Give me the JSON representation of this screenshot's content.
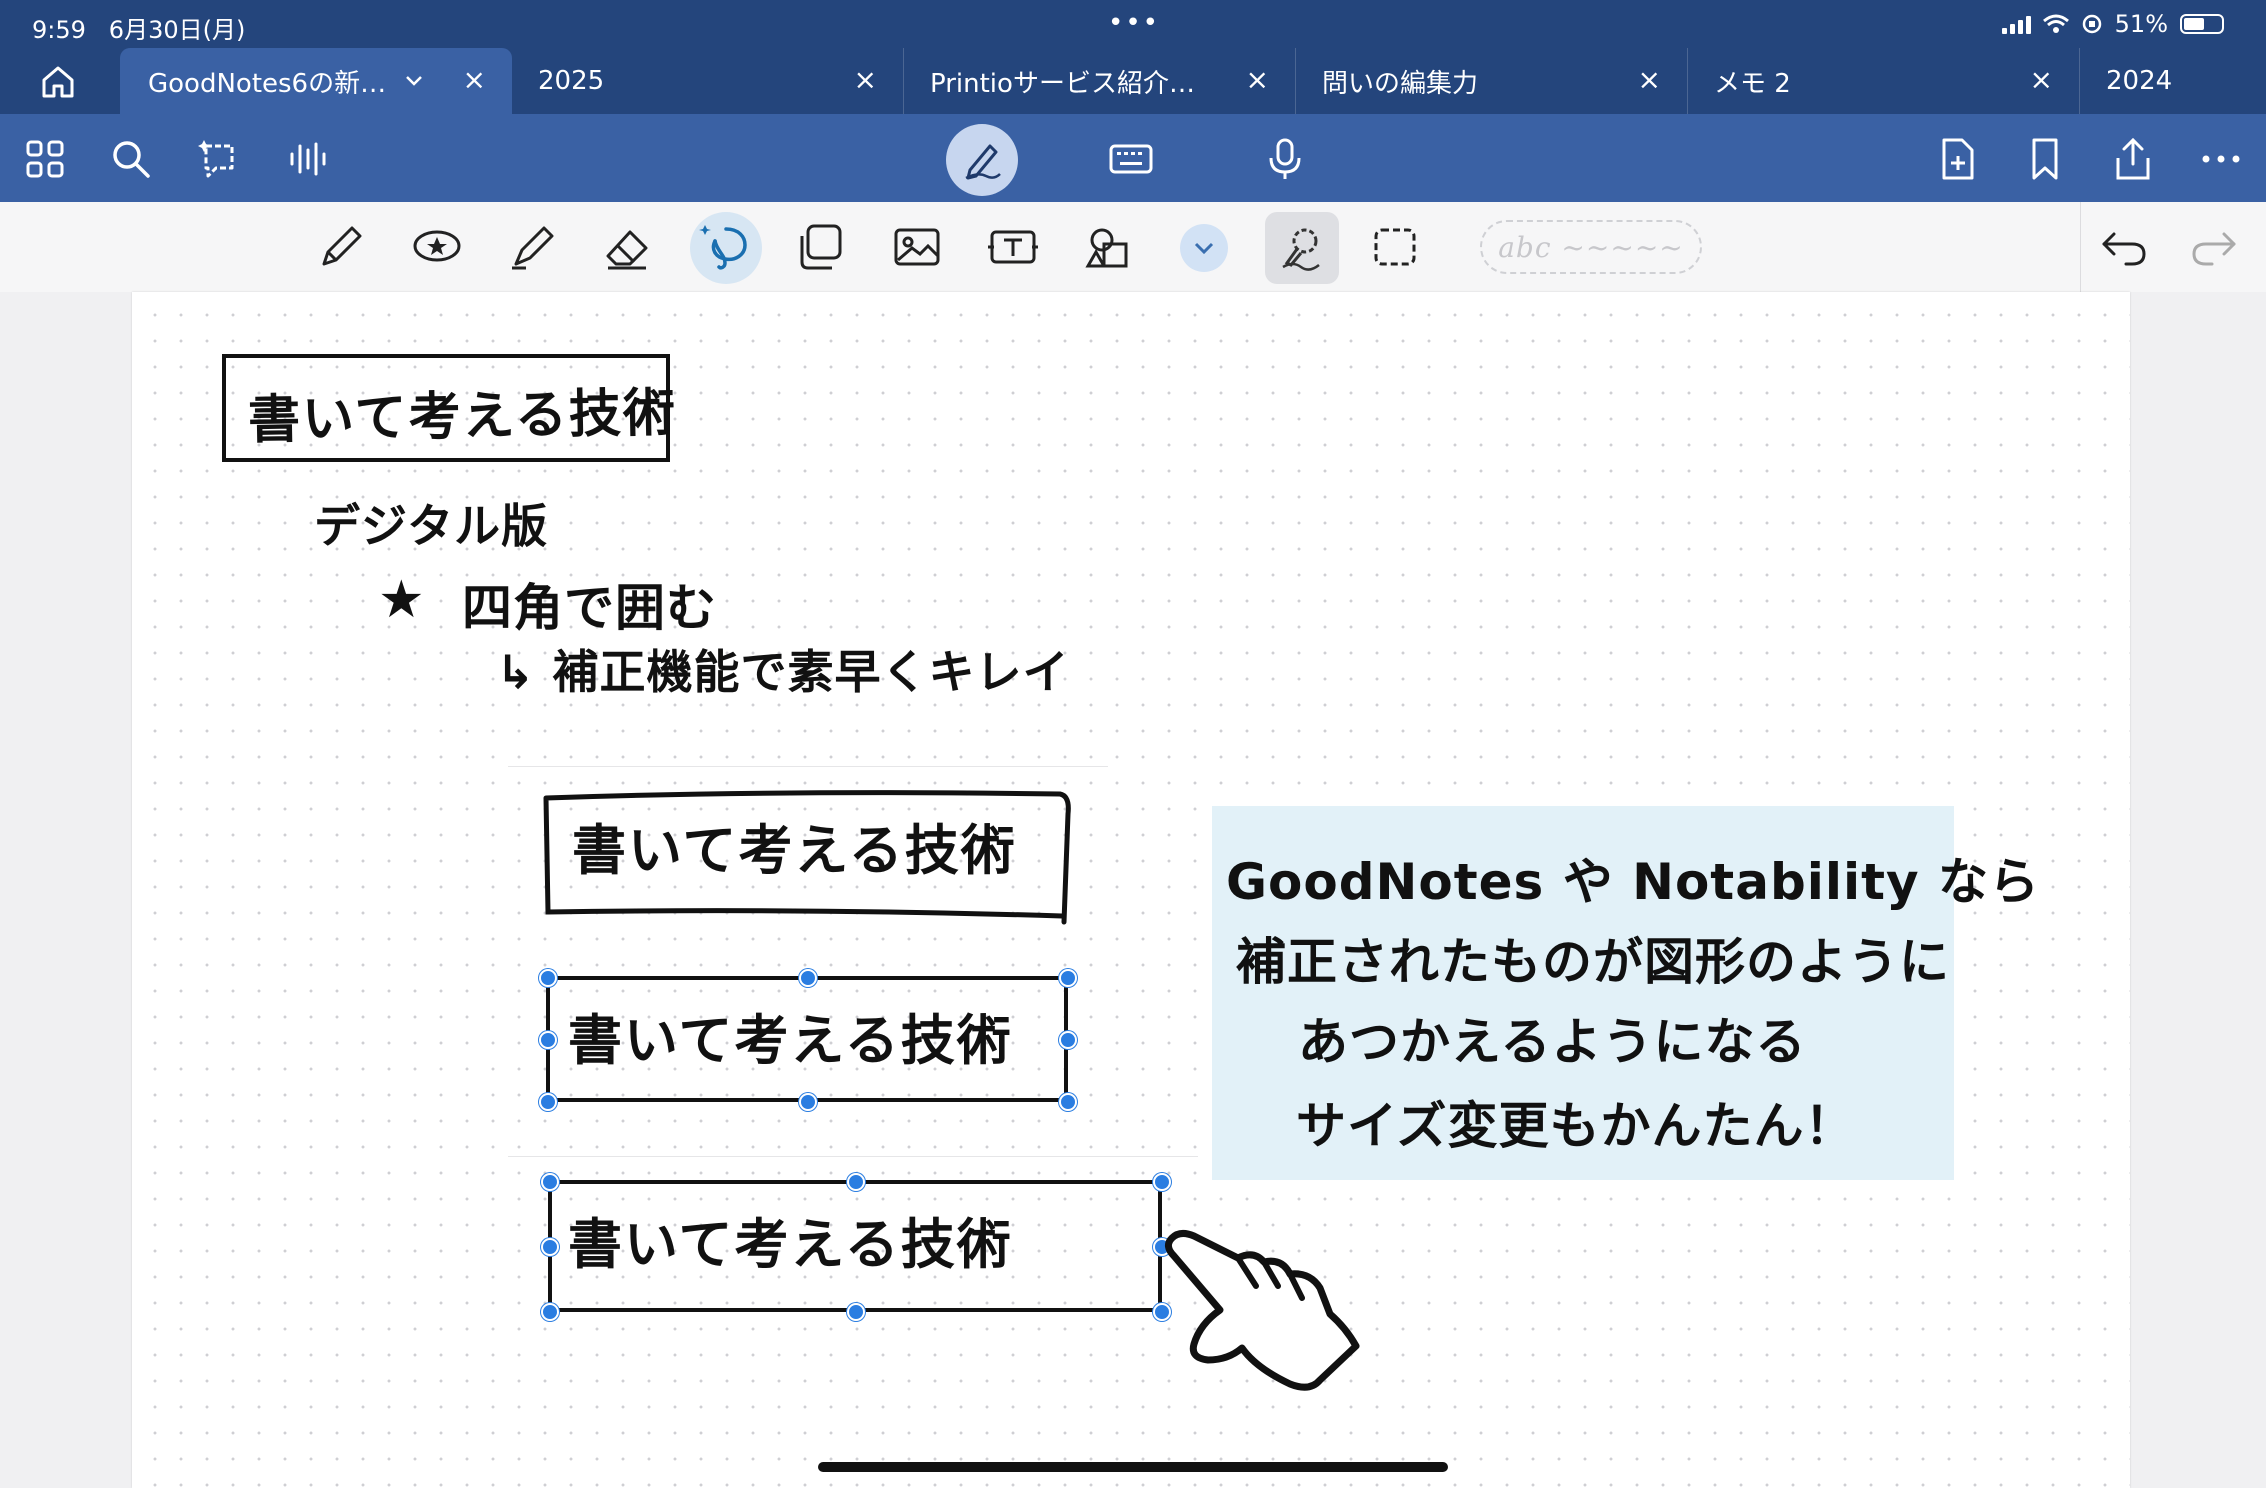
{
  "status": {
    "time": "9:59",
    "date": "6月30日(月)",
    "battery_pct": "51%"
  },
  "tabs": [
    {
      "label": "GoodNotes6の新…",
      "active": true
    },
    {
      "label": "2025"
    },
    {
      "label": "Printioサービス紹介…"
    },
    {
      "label": "問いの編集力"
    },
    {
      "label": "メモ 2"
    },
    {
      "label": "2024"
    }
  ],
  "toolbar": {
    "left_icons": [
      "grid-icon",
      "search-icon",
      "lasso-ai-icon",
      "audio-icon"
    ],
    "center_icons": [
      "pen-mode-icon",
      "keyboard-icon",
      "microphone-icon"
    ],
    "right_icons": [
      "add-page-icon",
      "bookmark-icon",
      "share-icon",
      "more-icon"
    ]
  },
  "tools": {
    "items": [
      "pen",
      "highlighter-shape",
      "highlighter",
      "eraser",
      "lasso",
      "sticker",
      "image",
      "text",
      "shapes",
      "more",
      "select",
      "rect-select"
    ],
    "handwriting_placeholder": "abc ~~~~~"
  },
  "page": {
    "title": "書いて考える技術",
    "subtitle": "デジタル版",
    "point_star": "★",
    "point": "四角で囲む",
    "note": "↳ 補正機能で素早くキレイ",
    "samples": [
      "書いて考える技術",
      "書いて考える技術",
      "書いて考える技術"
    ],
    "callout": [
      "GoodNotes や Notability なら",
      "補正されたものが図形のように",
      "あつかえるようになる",
      "サイズ変更もかんたん！"
    ]
  }
}
